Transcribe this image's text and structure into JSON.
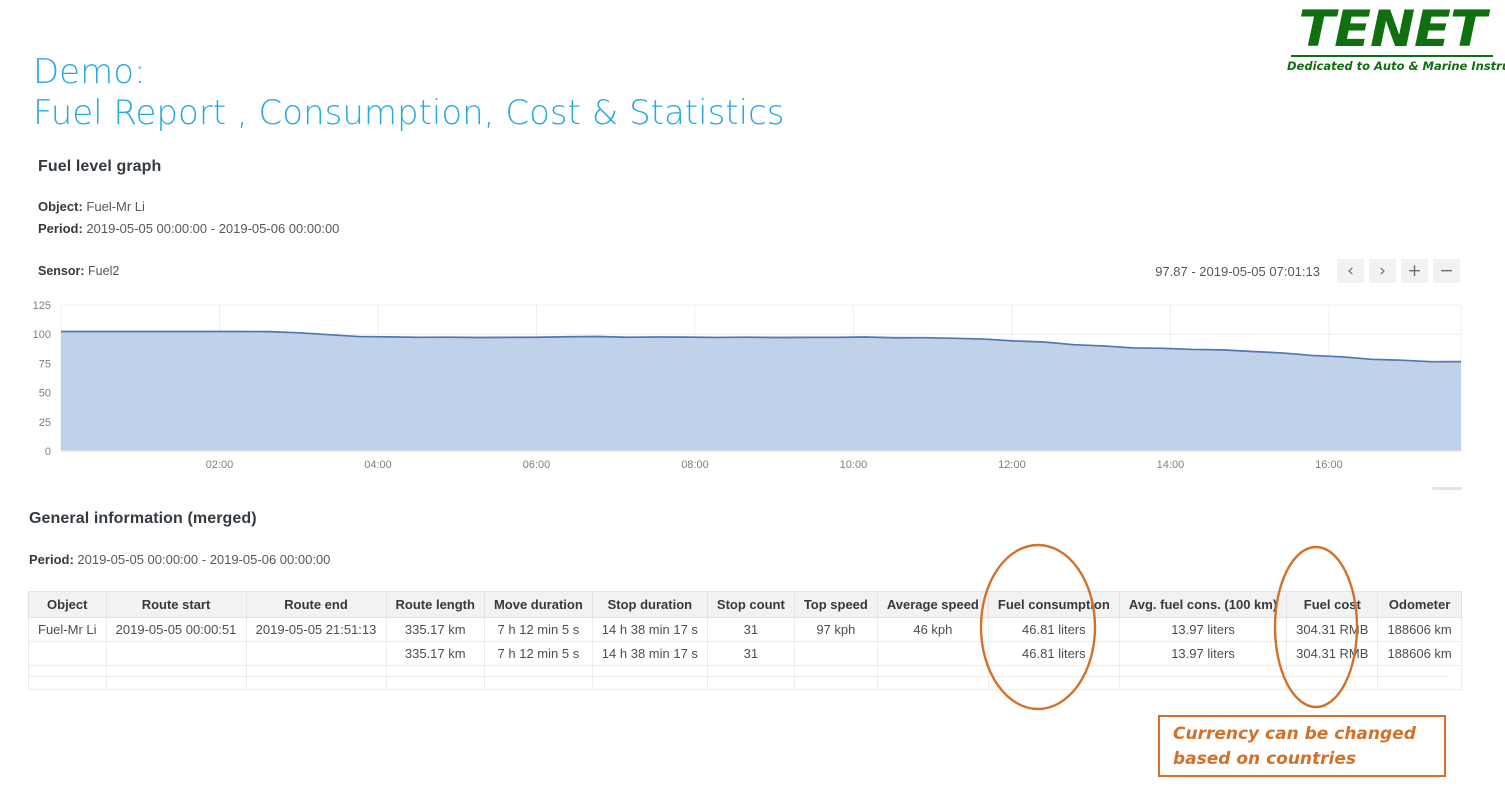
{
  "brand": {
    "name": "TENET",
    "tagline": "Dedicated to Auto & Marine Instruments",
    "color": "#107010"
  },
  "report": {
    "title_line1": "Demo:",
    "title_line2": "Fuel Report , Consumption, Cost & Statistics",
    "title_color": "#29a9e1"
  },
  "fuel_graph": {
    "heading": "Fuel level graph",
    "object_label": "Object:",
    "object_value": "Fuel-Mr Li",
    "period_label": "Period:",
    "period_value": "2019-05-05 00:00:00 - 2019-05-06 00:00:00",
    "sensor_label": "Sensor:",
    "sensor_value": "Fuel2",
    "readout": "97.87 - 2019-05-05 07:01:13",
    "buttons": {
      "prev": "‹",
      "next": "›",
      "zoom_in": "+",
      "zoom_out": "−"
    }
  },
  "general_info": {
    "heading": "General information (merged)",
    "period_label": "Period:",
    "period_value": "2019-05-05 00:00:00 - 2019-05-06 00:00:00",
    "columns": [
      "Object",
      "Route start",
      "Route end",
      "Route length",
      "Move duration",
      "Stop duration",
      "Stop count",
      "Top speed",
      "Average speed",
      "Fuel consumption",
      "Avg. fuel cons. (100 km)",
      "Fuel cost",
      "Odometer"
    ],
    "rows": [
      [
        "Fuel-Mr Li",
        "2019-05-05 00:00:51",
        "2019-05-05 21:51:13",
        "335.17 km",
        "7 h 12 min 5 s",
        "14 h 38 min 17 s",
        "31",
        "97 kph",
        "46 kph",
        "46.81 liters",
        "13.97 liters",
        "304.31 RMB",
        "188606 km"
      ],
      [
        "",
        "",
        "",
        "335.17 km",
        "7 h 12 min 5 s",
        "14 h 38 min 17 s",
        "31",
        "",
        "",
        "46.81 liters",
        "13.97 liters",
        "304.31 RMB",
        "188606 km"
      ],
      [
        "",
        "",
        "",
        "",
        "",
        "",
        "",
        "",
        "",
        "",
        "",
        "",
        ""
      ]
    ]
  },
  "annotations": {
    "color": "#d2722a",
    "note": "Currency can be changed\nbased on countries",
    "note_line1": "Currency can be changed",
    "note_line2": "based on countries",
    "highlighted_columns": [
      "Fuel consumption",
      "Fuel cost"
    ]
  },
  "chart_data": {
    "type": "area",
    "title": "Fuel level graph",
    "xlabel": "",
    "ylabel": "",
    "series_name": "Fuel2",
    "ylim": [
      0,
      125
    ],
    "yticks": [
      0,
      25,
      50,
      75,
      100,
      125
    ],
    "xticks": [
      "02:00",
      "04:00",
      "06:00",
      "08:00",
      "10:00",
      "12:00",
      "14:00",
      "16:00"
    ],
    "grid": true,
    "legend_position": "none",
    "fill_color": "#bdd0e8",
    "line_color": "#4f77b0",
    "x_domain": [
      "00:00",
      "17:40"
    ],
    "x": [
      "00:00",
      "00:30",
      "01:00",
      "01:30",
      "02:00",
      "02:30",
      "03:00",
      "03:20",
      "03:40",
      "03:50",
      "04:00",
      "04:20",
      "04:40",
      "05:00",
      "05:30",
      "06:00",
      "06:30",
      "07:00",
      "07:01",
      "07:20",
      "07:40",
      "08:00",
      "08:30",
      "09:00",
      "09:30",
      "10:00",
      "10:30",
      "11:00",
      "11:20",
      "11:40",
      "12:00",
      "12:20",
      "12:40",
      "13:00",
      "13:20",
      "13:40",
      "14:00",
      "14:20",
      "14:40",
      "15:00",
      "15:20",
      "15:40",
      "16:00",
      "16:20",
      "16:40",
      "17:00",
      "17:20",
      "17:40"
    ],
    "values": [
      102.3,
      102.3,
      102.3,
      102.3,
      102.3,
      102.3,
      102.3,
      102.2,
      101.2,
      99.6,
      98.0,
      97.6,
      97.4,
      97.3,
      97.3,
      97.3,
      97.3,
      97.9,
      97.87,
      97.5,
      97.6,
      97.4,
      97.3,
      97.3,
      97.3,
      97.3,
      97.4,
      97.3,
      97.2,
      96.8,
      96.5,
      95.6,
      94.4,
      93.0,
      91.3,
      89.8,
      88.4,
      87.6,
      87.2,
      86.4,
      85.2,
      83.7,
      82.0,
      80.3,
      78.8,
      77.6,
      76.6,
      76.2
    ],
    "annotation_point": {
      "value": 97.87,
      "time": "2019-05-05 07:01:13"
    }
  }
}
